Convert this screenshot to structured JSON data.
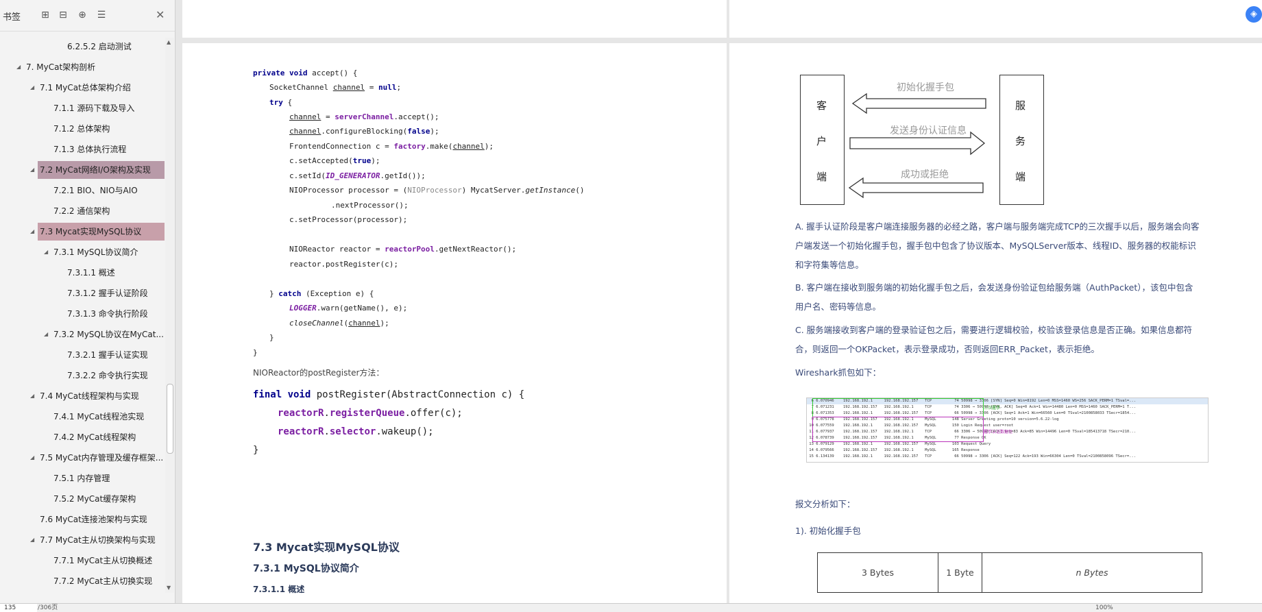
{
  "sidebar": {
    "title": "书签",
    "toc": [
      {
        "label": "6.2.5.2 启动测试",
        "level": 4,
        "arrow": ""
      },
      {
        "label": "7. MyCat架构剖析",
        "level": 1,
        "arrow": "◢"
      },
      {
        "label": "7.1 MyCat总体架构介绍",
        "level": 2,
        "arrow": "◢"
      },
      {
        "label": "7.1.1 源码下载及导入",
        "level": 3,
        "arrow": ""
      },
      {
        "label": "7.1.2 总体架构",
        "level": 3,
        "arrow": ""
      },
      {
        "label": "7.1.3 总体执行流程",
        "level": 3,
        "arrow": ""
      },
      {
        "label": "7.2 MyCat网络I/O架构及实现",
        "level": 2,
        "arrow": "◢"
      },
      {
        "label": "7.2.1 BIO、NIO与AIO",
        "level": 3,
        "arrow": ""
      },
      {
        "label": "7.2.2 通信架构",
        "level": 3,
        "arrow": ""
      },
      {
        "label": "7.3 Mycat实现MySQL协议",
        "level": 2,
        "arrow": "◢"
      },
      {
        "label": "7.3.1 MySQL协议简介",
        "level": 3,
        "arrow": "◢"
      },
      {
        "label": "7.3.1.1 概述",
        "level": 4,
        "arrow": ""
      },
      {
        "label": "7.3.1.2 握手认证阶段",
        "level": 4,
        "arrow": ""
      },
      {
        "label": "7.3.1.3 命令执行阶段",
        "level": 4,
        "arrow": ""
      },
      {
        "label": "7.3.2 MySQL协议在MyCat...",
        "level": 3,
        "arrow": "◢"
      },
      {
        "label": "7.3.2.1 握手认证实现",
        "level": 4,
        "arrow": ""
      },
      {
        "label": "7.3.2.2 命令执行实现",
        "level": 4,
        "arrow": ""
      },
      {
        "label": "7.4 MyCat线程架构与实现",
        "level": 2,
        "arrow": "◢"
      },
      {
        "label": "7.4.1 MyCat线程池实现",
        "level": 3,
        "arrow": ""
      },
      {
        "label": "7.4.2 MyCat线程架构",
        "level": 3,
        "arrow": ""
      },
      {
        "label": "7.5 MyCat内存管理及缓存框架...",
        "level": 2,
        "arrow": "◢"
      },
      {
        "label": "7.5.1 内存管理",
        "level": 3,
        "arrow": ""
      },
      {
        "label": "7.5.2 MyCat缓存架构",
        "level": 3,
        "arrow": ""
      },
      {
        "label": "7.6 MyCat连接池架构与实现",
        "level": 2,
        "arrow": ""
      },
      {
        "label": "7.7 MyCat主从切换架构与实现",
        "level": 2,
        "arrow": "◢"
      },
      {
        "label": "7.7.1 MyCat主从切换概述",
        "level": 3,
        "arrow": ""
      },
      {
        "label": "7.7.2 MyCat主从切换实现",
        "level": 3,
        "arrow": ""
      }
    ]
  },
  "left_page": {
    "code_lines": [
      "private void accept() {",
      "SocketChannel channel = null;",
      "try {",
      "channel = serverChannel.accept();",
      "channel.configureBlocking(false);",
      "FrontendConnection c = factory.make(channel);",
      "c.setAccepted(true);",
      "c.setId(ID_GENERATOR.getId());",
      "NIOProcessor processor = (NIOProcessor) MycatServer.getInstance()",
      ".nextProcessor();",
      "c.setProcessor(processor);",
      "NIOReactor reactor = reactorPool.getNextReactor();",
      "reactor.postRegister(c);",
      "} catch (Exception e) {",
      "LOGGER.warn(getName(), e);",
      "closeChannel(channel);",
      "}",
      "}"
    ],
    "note": "NIOReactor的postRegister方法：",
    "code2": [
      "final void postRegister(AbstractConnection c) {",
      "reactorR.registerQueue.offer(c);",
      "reactorR.selector.wakeup();",
      "}"
    ],
    "h2": "7.3 Mycat实现MySQL协议",
    "h3": "7.3.1 MySQL协议简介",
    "h4": "7.3.1.1 概述"
  },
  "right_page": {
    "diagram": {
      "client": [
        "客",
        "户",
        "端"
      ],
      "server": [
        "服",
        "务",
        "端"
      ],
      "arrow1": "初始化握手包",
      "arrow2": "发送身份认证信息",
      "arrow3": "成功或拒绝"
    },
    "para_a": "A. 握手认证阶段是客户端连接服务器的必经之路，客户端与服务端完成TCP的三次握手以后，服务端会向客户端发送一个初始化握手包，握手包中包含了协议版本、MySQLServer版本、线程ID、服务器的权能标识和字符集等信息。",
    "para_b": "B. 客户端在接收到服务端的初始化握手包之后，会发送身份验证包给服务端（AuthPacket），该包中包含用户名、密码等信息。",
    "para_c": "C. 服务端接收到客户端的登录验证包之后，需要进行逻辑校验，校验该登录信息是否正确。如果信息都符合，则返回一个OKPacket，表示登录成功，否则返回ERR_Packet，表示拒绝。",
    "ws_title": "Wireshark抓包如下：",
    "ws_rows": [
      "  6 6.070946    192.168.192.1     192.168.192.157   TCP          74 50998 → 3306 [SYN] Seq=0 Win=8192 Len=0 MSS=1460 WS=256 SACK_PERM=1 TSval=...",
      "  7 6.071231    192.168.192.157   192.168.192.1     TCP          74 3306 → 50998 [SYN, ACK] Seq=0 Ack=1 Win=14480 Len=0 MSS=1460 SACK_PERM=1 T...",
      "  8 6.071353    192.168.192.1     192.168.192.157   TCP          66 50998 → 3306 [ACK] Seq=1 Ack=1 Win=66560 Len=0 TSval=2100858033 TSecr=1854...",
      "  9 6.075778    192.168.192.157   192.168.192.1     MySQL       148 Server Greeting proto=10 version=5.6.22-log",
      " 10 6.077559    192.168.192.1     192.168.192.157   MySQL       150 Login Request user=root",
      " 11 6.077937    192.168.192.157   192.168.192.1     TCP          66 3306 → 50998 [ACK] Seq=83 Ack=85 Win=14496 Len=0 TSval=185413718 TSecr=210...",
      " 12 6.078739    192.168.192.157   192.168.192.1     MySQL        77 Response OK",
      " 13 6.079129    192.168.192.1     192.168.192.157   MySQL       103 Request Query",
      " 14 6.079566    192.168.192.157   192.168.192.1     MySQL       165 Response",
      " 15 6.134139    192.168.192.1     192.168.192.157   TCP          66 50998 → 3306 [ACK] Seq=122 Ack=193 Win=66304 Len=0 TSval=2100858096 TSecr=..."
    ],
    "ws_note1": "三次握手",
    "ws_note2": "握手认证数据包",
    "analysis": "报文分析如下：",
    "item1": "1). 初始化握手包",
    "pkt_cells": [
      "3 Bytes",
      "1 Byte",
      "n Bytes"
    ]
  },
  "status": {
    "page": "135",
    "total": "/306页",
    "zoom": "100%"
  },
  "colors": {
    "selected1": "#b89aa8",
    "selected2": "#c8a0aa",
    "accent": "#3b82f6"
  }
}
